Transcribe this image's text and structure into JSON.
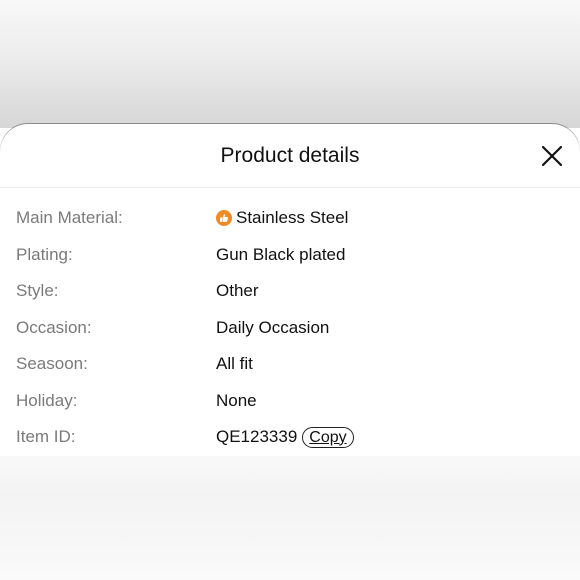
{
  "sheet": {
    "title": "Product details",
    "close_icon": "close-icon"
  },
  "details": [
    {
      "label": "Main Material:",
      "value": "Stainless Steel",
      "icon": "thumbs-up-badge-icon",
      "icon_color": "#f08a24"
    },
    {
      "label": "Plating:",
      "value": "Gun Black plated"
    },
    {
      "label": "Style:",
      "value": "Other"
    },
    {
      "label": "Occasion:",
      "value": "Daily Occasion"
    },
    {
      "label": "Seasoon:",
      "value": "All fit"
    },
    {
      "label": "Holiday:",
      "value": "None"
    },
    {
      "label": "Item ID:",
      "value": "QE123339",
      "action": "Copy"
    }
  ],
  "colors": {
    "label": "#7a7a7a",
    "value": "#111111",
    "badge": "#f08a24"
  }
}
